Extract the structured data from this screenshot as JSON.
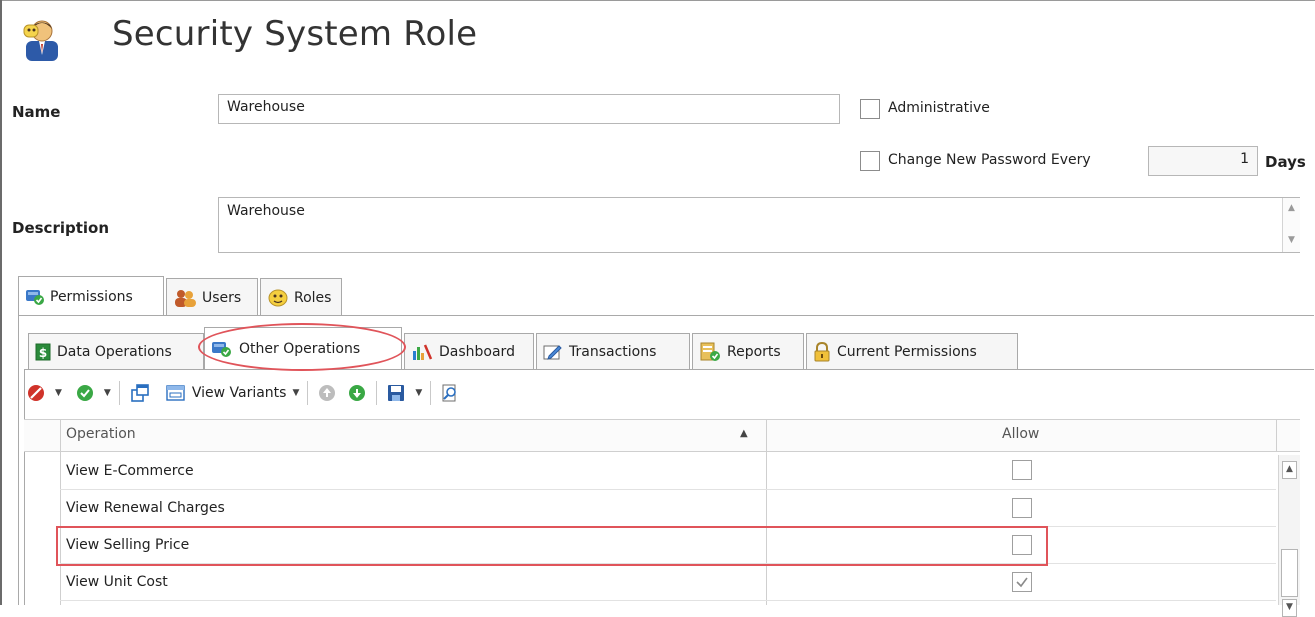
{
  "title": "Security System Role",
  "form": {
    "name_label": "Name",
    "name_value": "Warehouse",
    "administrative_label": "Administrative",
    "change_password_label": "Change New Password Every",
    "change_password_value": "1",
    "days_label": "Days",
    "description_label": "Description",
    "description_value": "Warehouse"
  },
  "main_tabs": [
    {
      "label": "Permissions",
      "icon": "permissions-icon",
      "active": true
    },
    {
      "label": "Users",
      "icon": "users-icon",
      "active": false
    },
    {
      "label": "Roles",
      "icon": "roles-icon",
      "active": false
    }
  ],
  "sub_tabs": [
    {
      "label": "Data Operations",
      "icon": "dollar-icon",
      "active": false
    },
    {
      "label": "Other Operations",
      "icon": "other-operations-icon",
      "active": true
    },
    {
      "label": "Dashboard",
      "icon": "chart-icon",
      "active": false
    },
    {
      "label": "Transactions",
      "icon": "pencil-icon",
      "active": false
    },
    {
      "label": "Reports",
      "icon": "report-icon",
      "active": false
    },
    {
      "label": "Current Permissions",
      "icon": "lock-icon",
      "active": false
    }
  ],
  "toolbar": {
    "view_variants_label": "View Variants"
  },
  "grid": {
    "columns": [
      "Operation",
      "Allow"
    ],
    "rows": [
      {
        "operation": "View E-Commerce",
        "allow": false
      },
      {
        "operation": "View Renewal Charges",
        "allow": false
      },
      {
        "operation": "View Selling Price",
        "allow": false
      },
      {
        "operation": "View Unit Cost",
        "allow": true
      }
    ]
  },
  "colors": {
    "highlight_red": "#e0545a",
    "border": "#a9a9a9"
  }
}
